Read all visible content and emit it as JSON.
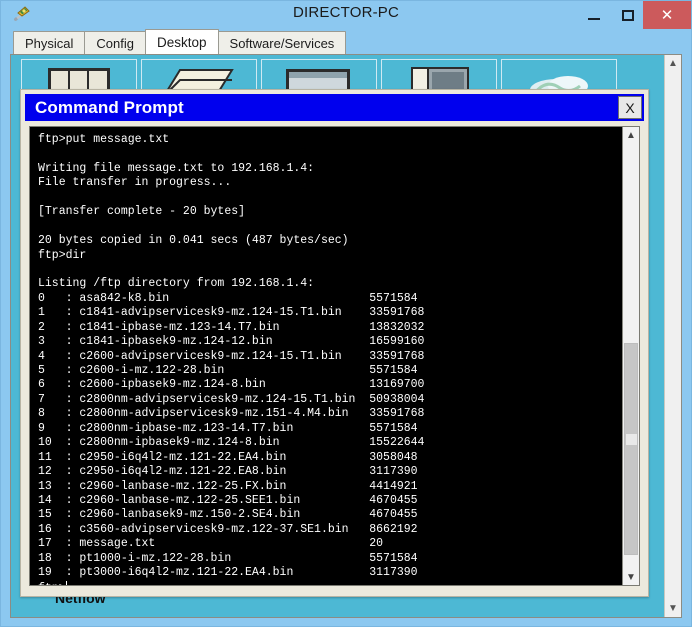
{
  "window": {
    "title": "DIRECTOR-PC",
    "icon": "packet-tracer-icon",
    "minimize_label": "–",
    "maximize_label": "□",
    "close_label": "✕"
  },
  "tabs": [
    {
      "label": "Physical",
      "active": false
    },
    {
      "label": "Config",
      "active": false
    },
    {
      "label": "Desktop",
      "active": true
    },
    {
      "label": "Software/Services",
      "active": false
    }
  ],
  "desktop": {
    "netflow_label": "Netflow",
    "scroll_up_icon": "chevron-up-icon",
    "scroll_down_icon": "chevron-down-icon",
    "icons": [
      {
        "name": "ip-configuration-icon"
      },
      {
        "name": "dial-up-icon"
      },
      {
        "name": "terminal-icon"
      },
      {
        "name": "command-prompt-icon"
      },
      {
        "name": "web-browser-icon"
      }
    ]
  },
  "command_prompt": {
    "title": "Command Prompt",
    "close_label": "X",
    "scroll_up_icon": "chevron-up-icon",
    "scroll_down_icon": "chevron-down-icon",
    "lines": [
      "ftp>put message.txt",
      "",
      "Writing file message.txt to 192.168.1.4:",
      "File transfer in progress...",
      "",
      "[Transfer complete - 20 bytes]",
      "",
      "20 bytes copied in 0.041 secs (487 bytes/sec)",
      "ftp>dir",
      "",
      "Listing /ftp directory from 192.168.1.4:",
      "0   : asa842-k8.bin                             5571584",
      "1   : c1841-advipservicesk9-mz.124-15.T1.bin    33591768",
      "2   : c1841-ipbase-mz.123-14.T7.bin             13832032",
      "3   : c1841-ipbasek9-mz.124-12.bin              16599160",
      "4   : c2600-advipservicesk9-mz.124-15.T1.bin    33591768",
      "5   : c2600-i-mz.122-28.bin                     5571584",
      "6   : c2600-ipbasek9-mz.124-8.bin               13169700",
      "7   : c2800nm-advipservicesk9-mz.124-15.T1.bin  50938004",
      "8   : c2800nm-advipservicesk9-mz.151-4.M4.bin   33591768",
      "9   : c2800nm-ipbase-mz.123-14.T7.bin           5571584",
      "10  : c2800nm-ipbasek9-mz.124-8.bin             15522644",
      "11  : c2950-i6q4l2-mz.121-22.EA4.bin            3058048",
      "12  : c2950-i6q4l2-mz.121-22.EA8.bin            3117390",
      "13  : c2960-lanbase-mz.122-25.FX.bin            4414921",
      "14  : c2960-lanbase-mz.122-25.SEE1.bin          4670455",
      "15  : c2960-lanbasek9-mz.150-2.SE4.bin          4670455",
      "16  : c3560-advipservicesk9-mz.122-37.SE1.bin   8662192",
      "17  : message.txt                               20",
      "18  : pt1000-i-mz.122-28.bin                    5571584",
      "19  : pt3000-i6q4l2-mz.121-22.EA4.bin           3117390",
      "ftp>"
    ]
  },
  "colors": {
    "window_chrome": "#8cc8f0",
    "close_button": "#cc5a5c",
    "desktop_bg": "#4db8d4",
    "cmd_titlebar": "#0000ee",
    "terminal_bg": "#000000",
    "terminal_fg": "#ffffff",
    "panel_bg": "#ece9dd"
  }
}
